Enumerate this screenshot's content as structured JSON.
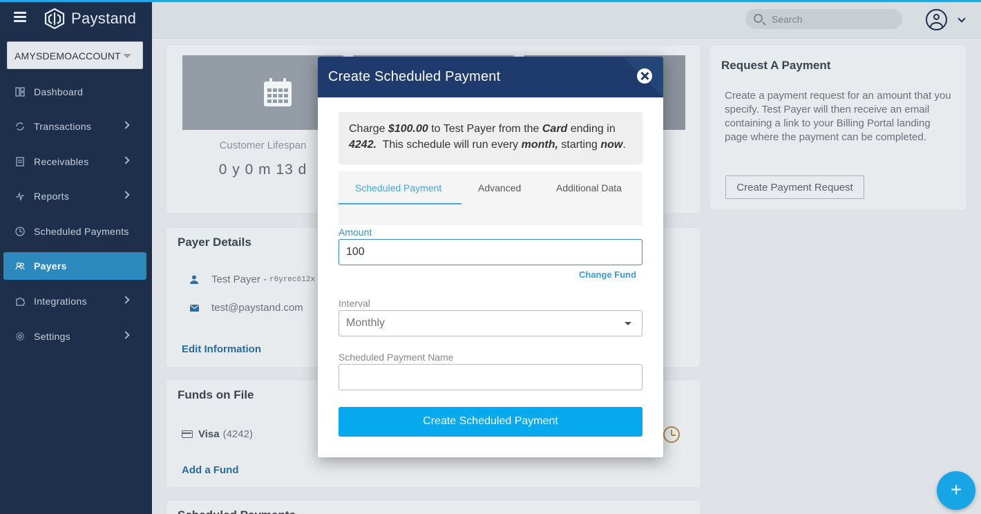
{
  "app": {
    "brand": "Paystand"
  },
  "sidebar": {
    "account": "AMYSDEMOACCOUNT",
    "items": [
      {
        "label": "Dashboard",
        "icon": "dashboard-icon",
        "chevron": false,
        "active": false
      },
      {
        "label": "Transactions",
        "icon": "transactions-icon",
        "chevron": true,
        "active": false
      },
      {
        "label": "Receivables",
        "icon": "receivables-icon",
        "chevron": true,
        "active": false
      },
      {
        "label": "Reports",
        "icon": "reports-icon",
        "chevron": true,
        "active": false
      },
      {
        "label": "Scheduled Payments",
        "icon": "clock-icon",
        "chevron": false,
        "active": false
      },
      {
        "label": "Payers",
        "icon": "users-icon",
        "chevron": false,
        "active": true
      },
      {
        "label": "Integrations",
        "icon": "puzzle-icon",
        "chevron": true,
        "active": false
      },
      {
        "label": "Settings",
        "icon": "gear-icon",
        "chevron": true,
        "active": false
      }
    ]
  },
  "header": {
    "search_placeholder": "Search"
  },
  "stats": {
    "label": "Customer Lifespan",
    "value": "0 y 0 m 13 d"
  },
  "request_payment": {
    "title": "Request A Payment",
    "description": "Create a payment request for an amount that you specify. Test Payer will then receive an email containing a link to your Billing Portal landing page where the payment can be completed.",
    "button": "Create Payment Request"
  },
  "payer_details": {
    "title": "Payer Details",
    "name": "Test Payer -",
    "id": "r6yrec612x",
    "email": "test@paystand.com",
    "edit_link": "Edit Information"
  },
  "funds": {
    "title": "Funds on File",
    "card_brand": "Visa",
    "card_last4": "(4242)",
    "add_link": "Add a Fund"
  },
  "scheduled_section": {
    "title": "Scheduled Payments"
  },
  "modal": {
    "title": "Create Scheduled Payment",
    "summary": {
      "p1": "Charge ",
      "amount": "$100.00",
      "p2": " to Test Payer from the ",
      "method": "Card",
      "p3": " ending in ",
      "last4": "4242.",
      "p4": "  This schedule will run every ",
      "interval": "month,",
      "p5": " starting ",
      "start": "now",
      "p6": "."
    },
    "tabs": [
      "Scheduled Payment",
      "Advanced",
      "Additional Data"
    ],
    "amount_label": "Amount",
    "amount_value": "100",
    "change_fund": "Change Fund",
    "interval_label": "Interval",
    "interval_value": "Monthly",
    "name_label": "Scheduled Payment Name",
    "name_value": "",
    "submit": "Create Scheduled Payment"
  },
  "colors": {
    "sidebar_bg": "#1e2f4c",
    "active_nav": "#2d88bd",
    "modal_header": "#1f3a6c",
    "primary_button": "#06a9ee",
    "link": "#3a9bd2"
  }
}
